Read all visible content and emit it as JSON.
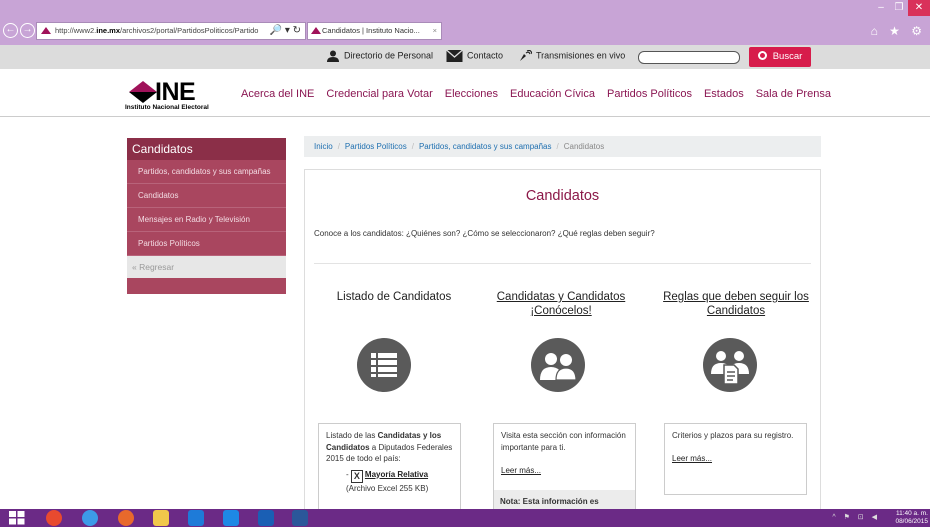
{
  "browser": {
    "address_host_prefix": "http://www2.",
    "address_host": "ine.mx",
    "address_path": "/archivos2/portal/PartidosPoliticos/Partido",
    "address_tools": "🔎 ▾ ↻",
    "tab_title": "Candidatos | Instituto Nacio...",
    "tab_close": "×",
    "back": "←",
    "forward": "→",
    "min": "–",
    "max": "❐",
    "close": "✕",
    "tool_icons": "⌂ ★ ⚙"
  },
  "utility": {
    "directorio": "Directorio de Personal",
    "contacto": "Contacto",
    "transmisiones": "Transmisiones en vivo",
    "search_placeholder": "",
    "search_button": "Buscar"
  },
  "header": {
    "logo_text": "INE",
    "logo_sub": "Instituto Nacional Electoral",
    "nav": [
      "Acerca del INE",
      "Credencial para Votar",
      "Elecciones",
      "Educación Cívica",
      "Partidos Políticos",
      "Estados",
      "Sala de Prensa"
    ]
  },
  "sidebar": {
    "title": "Candidatos",
    "items": [
      "Partidos, candidatos y sus campañas",
      "Candidatos",
      "Mensajes en Radio y Televisión",
      "Partidos Políticos"
    ],
    "back": "« Regresar"
  },
  "breadcrumb": {
    "items": [
      "Inicio",
      "Partidos Políticos",
      "Partidos, candidatos y sus campañas"
    ],
    "current": "Candidatos",
    "sep": "/"
  },
  "content": {
    "title": "Candidatos",
    "intro": "Conoce a los candidatos: ¿Quiénes son? ¿Cómo se seleccionaron? ¿Qué reglas deben seguir?",
    "col1": {
      "heading": "Listado de Candidatos",
      "text_a": "Listado de las ",
      "text_b": "Candidatas y los Candidatos",
      "text_c": " a Diputados Federales 2015 de todo el país:",
      "dash": "-",
      "xl_icon": "X",
      "link": "Mayoría Relativa",
      "file": "(Archivo Excel 255 KB)"
    },
    "col2": {
      "heading_1": "Candidatas y Candidatos",
      "heading_2": "¡Conócelos!",
      "text": "Visita esta sección con información importante para ti.",
      "link": "Leer más...",
      "note_label": "Nota:",
      "note_text": " Esta información es"
    },
    "col3": {
      "heading_1": "Reglas que deben seguir los",
      "heading_2": "Candidatos",
      "text": "Criterios y plazos para su registro.",
      "link": "Leer más..."
    }
  },
  "taskbar": {
    "time": "11:40 a. m.",
    "date": "08/06/2015",
    "tray": "^ ⚑ ⊡ ◀"
  },
  "colors": {
    "brand": "#8b1848",
    "sidebar": "#a9465f",
    "search_button": "#d71c4b",
    "chrome": "#c8a4d6",
    "taskbar": "#6b2a86"
  }
}
